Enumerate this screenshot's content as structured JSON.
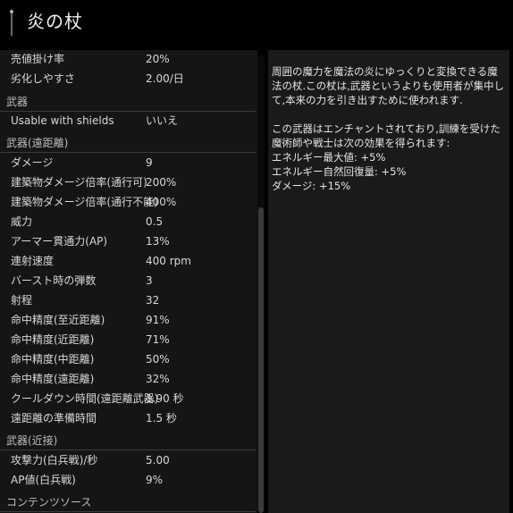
{
  "header": {
    "title": "炎の杖",
    "icon": "staff-icon"
  },
  "stats": {
    "top_rows": [
      {
        "label": "売値掛け率",
        "value": "20%"
      },
      {
        "label": "劣化しやすさ",
        "value": "2.00/日"
      }
    ],
    "section_weapon": "武器",
    "weapon_rows": [
      {
        "label": "Usable with shields",
        "value": "いいえ"
      }
    ],
    "section_ranged": "武器(遠距離)",
    "ranged_rows": [
      {
        "label": "ダメージ",
        "value": "9"
      },
      {
        "label": "建築物ダメージ倍率(通行可)",
        "value": "200%"
      },
      {
        "label": "建築物ダメージ倍率(通行不能)",
        "value": "400%"
      },
      {
        "label": "威力",
        "value": "0.5"
      },
      {
        "label": "アーマー貫通力(AP)",
        "value": "13%"
      },
      {
        "label": "連射速度",
        "value": "400 rpm"
      },
      {
        "label": "バースト時の弾数",
        "value": "3"
      },
      {
        "label": "射程",
        "value": "32"
      },
      {
        "label": "命中精度(至近距離)",
        "value": "91%"
      },
      {
        "label": "命中精度(近距離)",
        "value": "71%"
      },
      {
        "label": "命中精度(中距離)",
        "value": "50%"
      },
      {
        "label": "命中精度(遠距離)",
        "value": "32%"
      },
      {
        "label": "クールダウン時間(遠距離武器)",
        "value": "1.90 秒"
      },
      {
        "label": "遠距離の準備時間",
        "value": "1.5 秒"
      }
    ],
    "section_melee": "武器(近接)",
    "melee_rows": [
      {
        "label": "攻撃力(白兵戦)/秒",
        "value": "5.00"
      },
      {
        "label": "AP値(白兵戦)",
        "value": "9%"
      }
    ],
    "section_content": "コンテンツソース"
  },
  "description": {
    "para1": "周囲の魔力を魔法の炎にゆっくりと変換できる魔法の杖.この杖は,武器というよりも使用者が集中して,本来の力を引き出すために使われます.",
    "para2": "この武器はエンチャントされており,訓練を受けた魔術師や戦士は次の効果を得られます:",
    "effect1": "エネルギー最大値: +5%",
    "effect2": "エネルギー自然回復量: +5%",
    "effect3": "ダメージ: +15%"
  }
}
